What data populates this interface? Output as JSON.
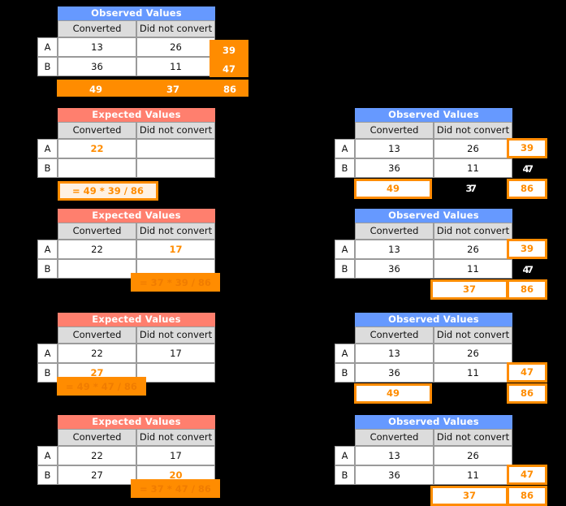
{
  "labels": {
    "observed_title": "Observed Values",
    "expected_title": "Expected Values",
    "col_converted": "Converted",
    "col_did_not_convert": "Did not convert",
    "row_a": "A",
    "row_b": "B"
  },
  "colors": {
    "observed_header": "#6699ff",
    "expected_header": "#ff7f6e",
    "highlight": "#ff8c00",
    "formula_fill": "#fff1e2",
    "col_header_bg": "#dcdcdc",
    "background": "#000000"
  },
  "observed": {
    "a_converted": "13",
    "a_did_not_convert": "26",
    "b_converted": "36",
    "b_did_not_convert": "11",
    "total_a": "39",
    "total_b": "47",
    "total_converted": "49",
    "total_did_not_convert": "37",
    "grand_total": "86"
  },
  "steps": [
    {
      "id": "step-0",
      "expected": {
        "a_converted": "",
        "a_did_not_convert": "",
        "b_converted": "",
        "b_did_not_convert": ""
      },
      "formula": "",
      "observed_totals": {
        "total_a": "39",
        "total_b": "47",
        "total_converted": "49",
        "total_did_not_convert": "37",
        "grand_total": "86"
      }
    },
    {
      "id": "step-1",
      "expected": {
        "a_converted": "22",
        "a_did_not_convert": "",
        "b_converted": "",
        "b_did_not_convert": ""
      },
      "formula": "= 49 * 39 / 86",
      "observed_totals": {
        "total_a": "39",
        "total_b": "47",
        "total_converted": "49",
        "total_did_not_convert": "37",
        "grand_total": "86"
      }
    },
    {
      "id": "step-2",
      "expected": {
        "a_converted": "22",
        "a_did_not_convert": "17",
        "b_converted": "",
        "b_did_not_convert": ""
      },
      "formula": "= 37 * 39 / 86",
      "observed_totals": {
        "total_a": "39",
        "total_b": "47",
        "total_converted": "",
        "total_did_not_convert": "37",
        "grand_total": "86"
      }
    },
    {
      "id": "step-3",
      "expected": {
        "a_converted": "22",
        "a_did_not_convert": "17",
        "b_converted": "27",
        "b_did_not_convert": ""
      },
      "formula": "= 49 * 47 / 86",
      "observed_totals": {
        "total_a": "",
        "total_b": "47",
        "total_converted": "49",
        "total_did_not_convert": "",
        "grand_total": "86"
      }
    },
    {
      "id": "step-4",
      "expected": {
        "a_converted": "22",
        "a_did_not_convert": "17",
        "b_converted": "27",
        "b_did_not_convert": "20"
      },
      "formula": "= 37 * 47 / 86",
      "observed_totals": {
        "total_a": "",
        "total_b": "47",
        "total_converted": "",
        "total_did_not_convert": "37",
        "grand_total": "86"
      }
    }
  ]
}
